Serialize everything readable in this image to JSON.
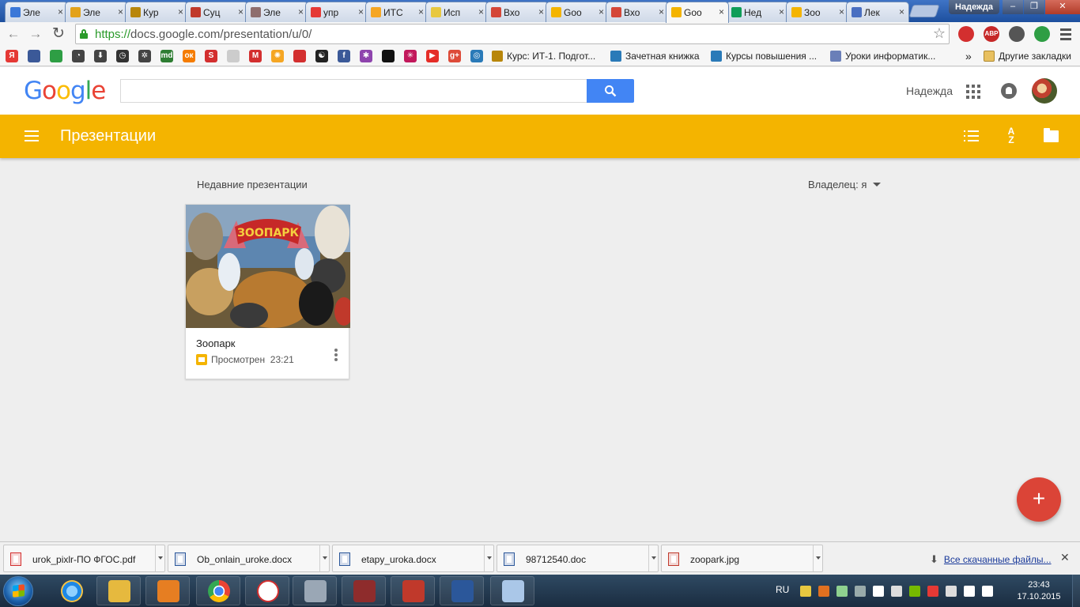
{
  "browser": {
    "tabs": [
      {
        "title": "Эле",
        "color": "#3b78d8"
      },
      {
        "title": "Эле",
        "color": "#e3a21a"
      },
      {
        "title": "Кур",
        "color": "#b8860b"
      },
      {
        "title": "Суц",
        "color": "#c0392b"
      },
      {
        "title": "Эле",
        "color": "#8e6e6e"
      },
      {
        "title": "упр",
        "color": "#e53935"
      },
      {
        "title": "ИТС",
        "color": "#f5a623"
      },
      {
        "title": "Исп",
        "color": "#e8c840"
      },
      {
        "title": "Вхо",
        "color": "#d44638"
      },
      {
        "title": "Goo",
        "color": "#f4b400"
      },
      {
        "title": "Вхо",
        "color": "#d44638"
      },
      {
        "title": "Goo",
        "color": "#f4b400"
      },
      {
        "title": "Нед",
        "color": "#0f9d58"
      },
      {
        "title": "Зоо",
        "color": "#f4b400"
      },
      {
        "title": "Лек",
        "color": "#4a6fc1"
      }
    ],
    "active_tab_index": 11,
    "close_glyph": "×",
    "profile_name": "Надежда",
    "window_controls": [
      "–",
      "❐",
      "✕"
    ],
    "nav": {
      "back": "←",
      "forward": "→",
      "reload": "↻"
    },
    "url_scheme": "https://",
    "url_rest": "docs.google.com/presentation/u/0/",
    "star": "☆",
    "extensions": [
      {
        "label": "",
        "color": "#d32f2f"
      },
      {
        "label": "ABP",
        "color": "#c62828"
      },
      {
        "label": "",
        "color": "#555555"
      },
      {
        "label": "",
        "color": "#2e9e44"
      }
    ],
    "bookmarks": {
      "icons": [
        {
          "glyph": "Я",
          "color": "#e53935"
        },
        {
          "glyph": "",
          "color": "#3b5998"
        },
        {
          "glyph": "",
          "color": "#2e9e44"
        },
        {
          "glyph": "◔",
          "color": "#444444"
        },
        {
          "glyph": "⬇",
          "color": "#444444"
        },
        {
          "glyph": "◷",
          "color": "#333333"
        },
        {
          "glyph": "✲",
          "color": "#444444"
        },
        {
          "glyph": "md",
          "color": "#2e7d32"
        },
        {
          "glyph": "ок",
          "color": "#f57c00"
        },
        {
          "glyph": "S",
          "color": "#d32f2f"
        },
        {
          "glyph": "",
          "color": "#cccccc"
        },
        {
          "glyph": "M",
          "color": "#d32f2f"
        },
        {
          "glyph": "✺",
          "color": "#f5a623"
        },
        {
          "glyph": "",
          "color": "#d32f2f"
        },
        {
          "glyph": "☯",
          "color": "#222222"
        },
        {
          "glyph": "f",
          "color": "#3b5998"
        },
        {
          "glyph": "✱",
          "color": "#8e44ad"
        },
        {
          "glyph": "",
          "color": "#111111"
        },
        {
          "glyph": "✳",
          "color": "#c2185b"
        },
        {
          "glyph": "▶",
          "color": "#e52d27"
        },
        {
          "glyph": "g+",
          "color": "#dd4b39"
        },
        {
          "glyph": "◎",
          "color": "#2a7ab8"
        }
      ],
      "named": [
        {
          "label": "Курс: ИТ-1. Подгот...",
          "color": "#b8860b"
        },
        {
          "label": "Зачетная книжка",
          "color": "#2a7ab8"
        },
        {
          "label": "Курсы повышения ...",
          "color": "#2a7ab8"
        },
        {
          "label": "Уроки информатик...",
          "color": "#6a7fb8"
        }
      ],
      "overflow": "»",
      "other": "Другие закладки"
    }
  },
  "google": {
    "logo_letters": [
      {
        "ch": "G",
        "color": "#4285f4"
      },
      {
        "ch": "o",
        "color": "#ea4335"
      },
      {
        "ch": "o",
        "color": "#fbbc05"
      },
      {
        "ch": "g",
        "color": "#4285f4"
      },
      {
        "ch": "l",
        "color": "#34a853"
      },
      {
        "ch": "e",
        "color": "#ea4335"
      }
    ],
    "search_value": "",
    "user_name": "Надежда"
  },
  "app": {
    "title": "Презентации",
    "accent": "#f4b400",
    "sort_label_top": "A",
    "sort_label_bottom": "Z",
    "section_title": "Недавние презентации",
    "owner_filter": "Владелец: я",
    "files": [
      {
        "name": "Зоопарк",
        "status": "Просмотрен",
        "time": "23:21",
        "thumb_text": "ЗООПАРК"
      }
    ],
    "fab_label": "+"
  },
  "downloads": {
    "items": [
      {
        "name": "urok_pixlr-ПО ФГОС.pdf",
        "color": "#d32f2f"
      },
      {
        "name": "Ob_onlain_uroke.docx",
        "color": "#2b579a"
      },
      {
        "name": "etapy_uroka.docx",
        "color": "#2b579a"
      },
      {
        "name": "98712540.doc",
        "color": "#2b579a"
      },
      {
        "name": "zoopark.jpg",
        "color": "#c0392b"
      }
    ],
    "all_label": "Все скачанные файлы...",
    "close": "✕"
  },
  "taskbar": {
    "apps": [
      {
        "name": "ie",
        "color": "#1e88e5"
      },
      {
        "name": "explorer",
        "color": "#e6b93e"
      },
      {
        "name": "media",
        "color": "#e67e22"
      },
      {
        "name": "chrome",
        "color": "#4285f4"
      },
      {
        "name": "yandex",
        "color": "#ffffff"
      },
      {
        "name": "calculator",
        "color": "#9aa7b5"
      },
      {
        "name": "winrar",
        "color": "#8e2c2c"
      },
      {
        "name": "xmind",
        "color": "#c0392b"
      },
      {
        "name": "word",
        "color": "#2b579a"
      },
      {
        "name": "paint",
        "color": "#aac7e8"
      }
    ],
    "lang": "RU",
    "tray_colors": [
      "#e8c840",
      "#e07020",
      "#8fd18f",
      "#9aa",
      "#ffffff",
      "#ddd",
      "#76b900",
      "#e53935",
      "#ddd",
      "#fff",
      "#fff"
    ],
    "time": "23:43",
    "date": "17.10.2015"
  }
}
